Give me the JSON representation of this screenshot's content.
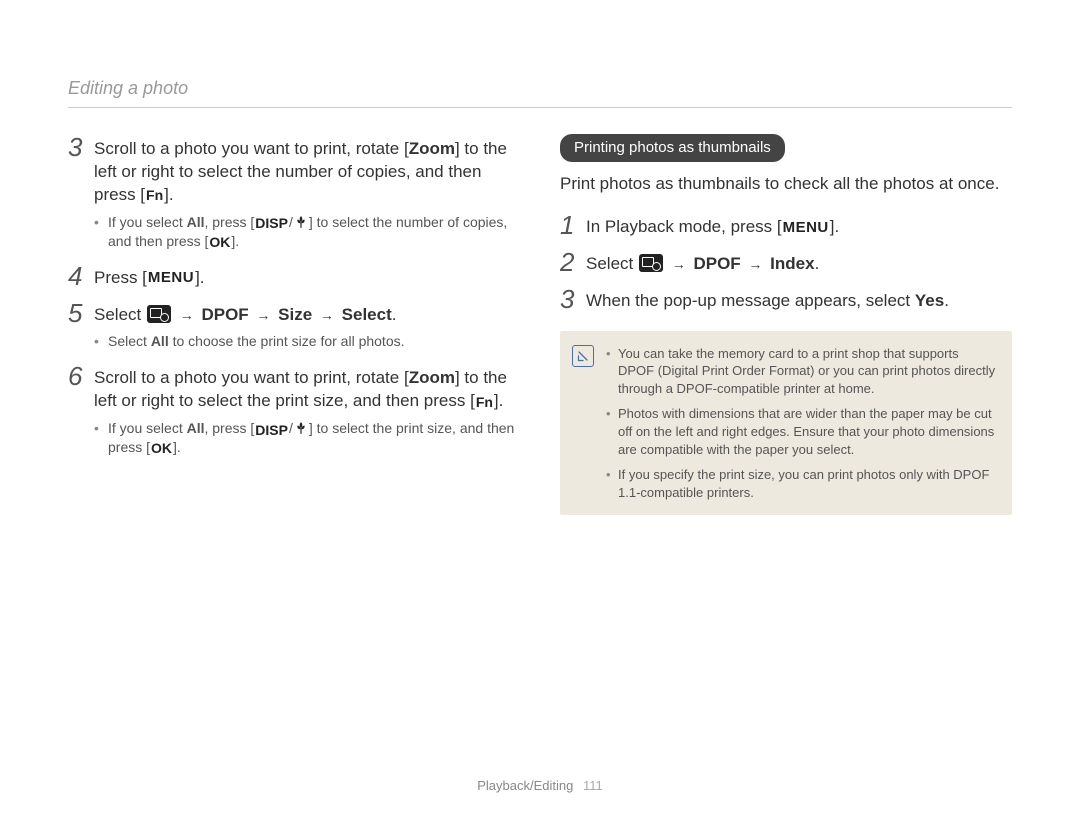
{
  "header": "Editing a photo",
  "left": {
    "steps": [
      {
        "num": "3",
        "parts": [
          {
            "t": "Scroll to a photo you want to print, rotate ["
          },
          {
            "t": "Zoom",
            "bold": true
          },
          {
            "t": "] to the left or right to select the number of copies, and then press ["
          },
          {
            "icon": "fn"
          },
          {
            "t": "]."
          }
        ],
        "bullets": [
          {
            "parts": [
              {
                "t": "If you select "
              },
              {
                "t": "All",
                "bold": true
              },
              {
                "t": ", press ["
              },
              {
                "icon": "disp"
              },
              {
                "t": "/"
              },
              {
                "icon": "macro"
              },
              {
                "t": "] to select the number of copies, and then press ["
              },
              {
                "icon": "ok"
              },
              {
                "t": "]."
              }
            ]
          }
        ]
      },
      {
        "num": "4",
        "parts": [
          {
            "t": "Press ["
          },
          {
            "icon": "menu"
          },
          {
            "t": "]."
          }
        ]
      },
      {
        "num": "5",
        "parts": [
          {
            "t": "Select "
          },
          {
            "icon": "image-settings"
          },
          {
            "t": " "
          },
          {
            "arrow": true
          },
          {
            "t": " "
          },
          {
            "t": "DPOF",
            "bold": true
          },
          {
            "t": " "
          },
          {
            "arrow": true
          },
          {
            "t": " "
          },
          {
            "t": "Size",
            "bold": true
          },
          {
            "t": " "
          },
          {
            "arrow": true
          },
          {
            "t": " "
          },
          {
            "t": "Select",
            "bold": true
          },
          {
            "t": "."
          }
        ],
        "bullets": [
          {
            "parts": [
              {
                "t": "Select "
              },
              {
                "t": "All",
                "bold": true
              },
              {
                "t": " to choose the print size for all photos."
              }
            ]
          }
        ]
      },
      {
        "num": "6",
        "parts": [
          {
            "t": "Scroll to a photo you want to print, rotate ["
          },
          {
            "t": "Zoom",
            "bold": true
          },
          {
            "t": "] to the left or right to select the print size, and then press ["
          },
          {
            "icon": "fn"
          },
          {
            "t": "]."
          }
        ],
        "bullets": [
          {
            "parts": [
              {
                "t": "If you select "
              },
              {
                "t": "All",
                "bold": true
              },
              {
                "t": ", press ["
              },
              {
                "icon": "disp"
              },
              {
                "t": "/"
              },
              {
                "icon": "macro"
              },
              {
                "t": "] to select the print size, and then press ["
              },
              {
                "icon": "ok"
              },
              {
                "t": "]."
              }
            ]
          }
        ]
      }
    ]
  },
  "right": {
    "badge": "Printing photos as thumbnails",
    "intro": "Print photos as thumbnails to check all the photos at once.",
    "steps": [
      {
        "num": "1",
        "parts": [
          {
            "t": "In Playback mode, press ["
          },
          {
            "icon": "menu"
          },
          {
            "t": "]."
          }
        ]
      },
      {
        "num": "2",
        "parts": [
          {
            "t": "Select "
          },
          {
            "icon": "image-settings"
          },
          {
            "t": " "
          },
          {
            "arrow": true
          },
          {
            "t": " "
          },
          {
            "t": "DPOF",
            "bold": true
          },
          {
            "t": " "
          },
          {
            "arrow": true
          },
          {
            "t": " "
          },
          {
            "t": "Index",
            "bold": true
          },
          {
            "t": "."
          }
        ]
      },
      {
        "num": "3",
        "parts": [
          {
            "t": "When the pop-up message appears, select "
          },
          {
            "t": "Yes",
            "bold": true
          },
          {
            "t": "."
          }
        ]
      }
    ],
    "notes": [
      "You can take the memory card to a print shop that supports DPOF (Digital Print Order Format) or you can print photos directly through a DPOF-compatible printer at home.",
      "Photos with dimensions that are wider than the paper may be cut off on the left and right edges. Ensure that your photo dimensions are compatible with the paper you select.",
      "If you specify the print size, you can print photos only with DPOF 1.1-compatible printers."
    ]
  },
  "footer": {
    "section": "Playback/Editing",
    "page": "111"
  },
  "icon_labels": {
    "menu": "MENU",
    "fn": "Fn",
    "ok": "OK",
    "disp": "DISP"
  }
}
